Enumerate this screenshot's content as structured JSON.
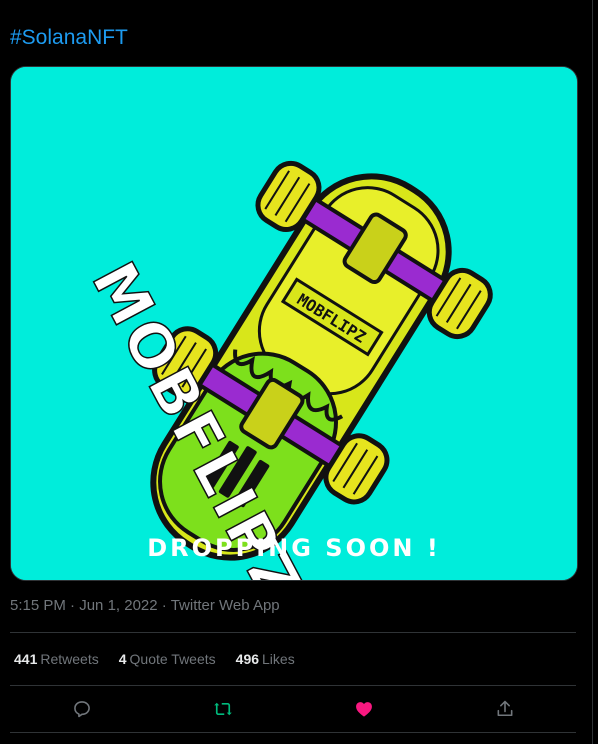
{
  "tweet": {
    "hashtag": "#SolanaNFT",
    "media": {
      "image_title": "MOBFLIPZ",
      "deck_label": "MOBFLIPZ",
      "caption": "DROPPING SOON !"
    },
    "time": "5:15 PM",
    "date": "Jun 1, 2022",
    "source": "Twitter Web App",
    "separator": "·",
    "stats": {
      "retweets_count": "441",
      "retweets_label": "Retweets",
      "quotes_count": "4",
      "quotes_label": "Quote Tweets",
      "likes_count": "496",
      "likes_label": "Likes"
    },
    "actions": {
      "reply_icon": "reply-icon",
      "retweet_icon": "retweet-icon",
      "like_icon": "heart-icon",
      "share_icon": "share-icon",
      "retweet_active_color": "#00ba7c",
      "like_active_color": "#f91880"
    },
    "colors": {
      "background": "#000000",
      "link": "#1d9bf0",
      "muted": "#71767b",
      "media_bg": "#00eddb"
    }
  }
}
